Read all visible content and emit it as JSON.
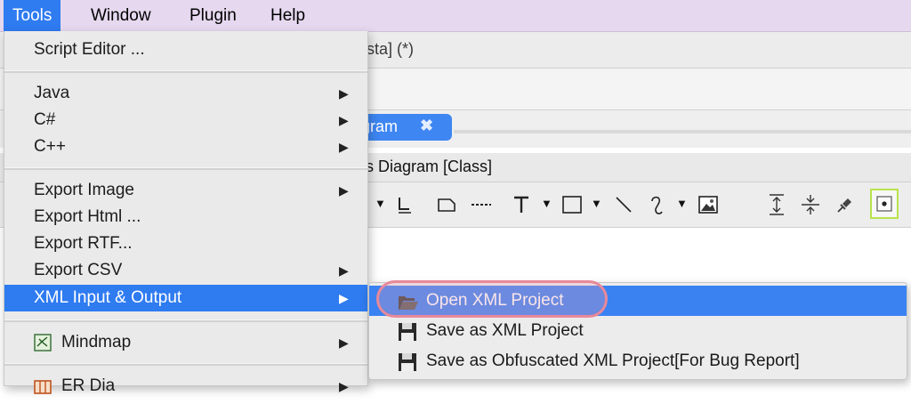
{
  "menubar": {
    "items": [
      {
        "label": "Tools",
        "active": true
      },
      {
        "label": "Window"
      },
      {
        "label": "Plugin"
      },
      {
        "label": "Help"
      }
    ]
  },
  "background_app": {
    "window_title_fragment": "asta] (*)",
    "active_tab_label": "gram",
    "tab_close_glyph": "✖",
    "panel_title_fragment": "ss Diagram [Class]"
  },
  "tools_menu": {
    "items": [
      {
        "label": "Script Editor ..."
      },
      {
        "label": "Java",
        "submenu": true
      },
      {
        "label": "C#",
        "submenu": true
      },
      {
        "label": "C++",
        "submenu": true
      },
      {
        "label": "Export Image",
        "submenu": true
      },
      {
        "label": "Export Html ..."
      },
      {
        "label": "Export RTF..."
      },
      {
        "label": "Export CSV",
        "submenu": true
      },
      {
        "label": "XML Input & Output",
        "submenu": true,
        "highlighted": true
      },
      {
        "label": "Mindmap",
        "submenu": true,
        "icon": "mindmap-icon"
      },
      {
        "label": "ER Dia",
        "submenu": true,
        "icon": "er-diagram-icon"
      }
    ]
  },
  "xml_submenu": {
    "items": [
      {
        "label": "Open XML Project",
        "icon": "folder-open-icon",
        "highlighted": true
      },
      {
        "label": "Save as XML Project",
        "icon": "floppy-disk-icon"
      },
      {
        "label": "Save as Obfuscated XML Project[For Bug Report]",
        "icon": "floppy-disk-icon"
      }
    ]
  },
  "colors": {
    "menubar_bg": "#e6d8ef",
    "highlight": "#2f7bf0",
    "menu_bg": "#eaeaea",
    "focus_ring": "#e8899a",
    "selected_tool_border": "#b8e34a"
  }
}
